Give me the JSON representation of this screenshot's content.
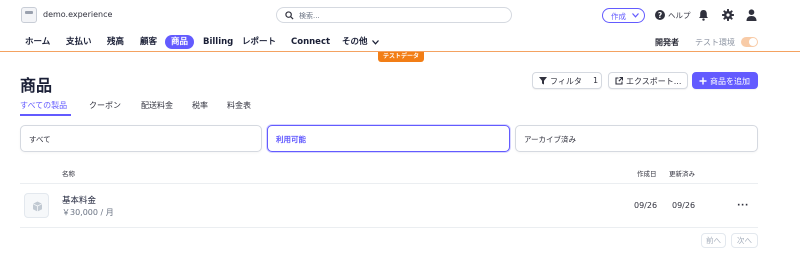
{
  "topbar": {
    "account_name": "demo.experience",
    "search_placeholder": "検索...",
    "create_label": "作成",
    "help_label": "ヘルプ"
  },
  "nav": {
    "items": [
      {
        "label": "ホーム",
        "active": false
      },
      {
        "label": "支払い",
        "active": false
      },
      {
        "label": "残高",
        "active": false
      },
      {
        "label": "顧客",
        "active": false
      },
      {
        "label": "商品",
        "active": true
      },
      {
        "label": "Billing",
        "active": false
      },
      {
        "label": "レポート",
        "active": false
      },
      {
        "label": "Connect",
        "active": false
      },
      {
        "label": "その他",
        "active": false
      }
    ],
    "developer_label": "開発者",
    "test_mode_label": "テスト環境",
    "test_data_banner": "テストデータ"
  },
  "page": {
    "title": "商品",
    "filter_label": "フィルタ",
    "filter_count": "1",
    "export_label": "エクスポート...",
    "add_label": "商品を追加"
  },
  "tabs": [
    "すべての製品",
    "クーポン",
    "配送料金",
    "税率",
    "料金表"
  ],
  "segments": [
    "すべて",
    "利用可能",
    "アーカイブ済み"
  ],
  "table": {
    "headers": {
      "name": "名称",
      "created": "作成日",
      "updated": "更新済み"
    },
    "rows": [
      {
        "name": "基本料金",
        "price": "￥30,000 / 月",
        "created": "09/26",
        "updated": "09/26"
      }
    ]
  },
  "pagination": {
    "prev": "前へ",
    "next": "次へ"
  },
  "colors": {
    "accent": "#635bff",
    "test_mode": "#f27e16"
  }
}
